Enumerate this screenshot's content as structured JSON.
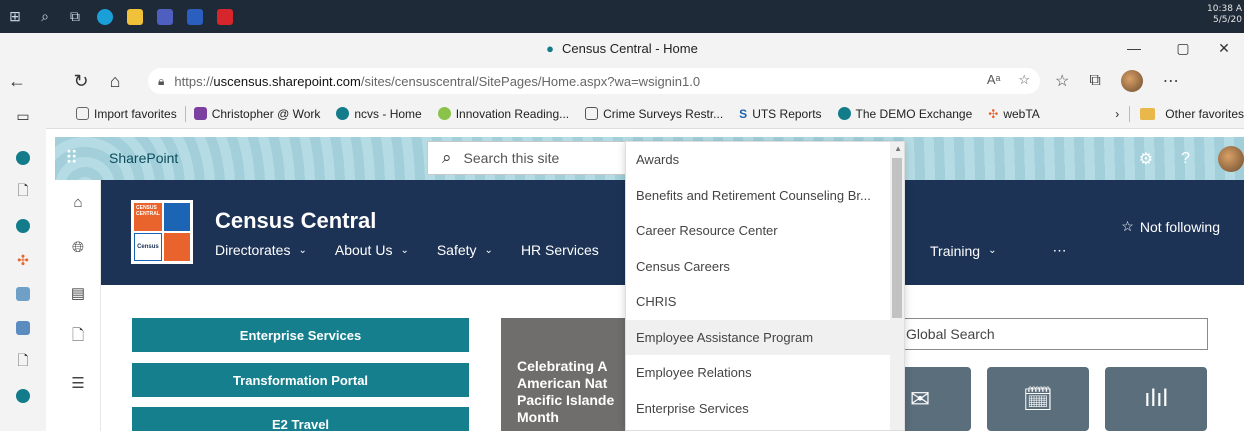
{
  "taskbar": {
    "clock_time": "10:38 A",
    "clock_date": "5/5/20"
  },
  "window": {
    "title": "Census Central - Home",
    "minimize": "—",
    "restore": "▢",
    "close": "✕"
  },
  "address": {
    "url_prefix": "https://",
    "url_host": "uscensus.sharepoint.com",
    "url_path": "/sites/censuscentral/SitePages/Home.aspx?wa=wsignin1.0",
    "read_aloud": "Aᵃ",
    "more": "⋯"
  },
  "favorites": {
    "items": [
      {
        "label": "Import favorites",
        "color": "#666666"
      },
      {
        "label": "Christopher @ Work",
        "color": "#7b3fa0"
      },
      {
        "label": "ncvs - Home",
        "color": "#137c8a"
      },
      {
        "label": "Innovation Reading...",
        "color": "#8bc34a"
      },
      {
        "label": "Crime Surveys Restr...",
        "color": "#555555"
      },
      {
        "label": "UTS Reports",
        "color": "#1c64b4"
      },
      {
        "label": "The DEMO Exchange",
        "color": "#137c8a"
      },
      {
        "label": "webTA",
        "color": "#e8642c"
      }
    ],
    "overflow": "›",
    "other_favorites": "Other favorites"
  },
  "suite": {
    "app_name": "SharePoint",
    "search_placeholder": "Search this site"
  },
  "site": {
    "logo_text_top": "CENSUS CENTRAL",
    "logo_text_bottom": "Census",
    "title": "Census Central",
    "nav": [
      {
        "label": "Directorates",
        "chevron": "⌄"
      },
      {
        "label": "About Us",
        "chevron": "⌄"
      },
      {
        "label": "Safety",
        "chevron": "⌄"
      },
      {
        "label": "HR Services",
        "chevron": ""
      }
    ],
    "nav_right": [
      {
        "label": "Training",
        "chevron": "⌄"
      },
      {
        "label": "⋯",
        "chevron": ""
      }
    ],
    "not_following": "Not following"
  },
  "content": {
    "quick_links": [
      "Enterprise Services",
      "Transformation Portal",
      "E2 Travel"
    ],
    "hero_text": [
      "Celebrating A",
      "American Nat",
      "Pacific Islande",
      "Month"
    ],
    "global_search_placeholder": "Global Search"
  },
  "dropdown": {
    "items": [
      "Awards",
      "Benefits and Retirement Counseling Br...",
      "Career Resource Center",
      "Census Careers",
      "CHRIS",
      "Employee Assistance Program",
      "Employee Relations",
      "Enterprise Services"
    ],
    "hover_index": 5
  },
  "colors": {
    "suite_bar": "#a9d4de",
    "site_header": "#1c3355",
    "quick_link": "#157f8d",
    "tile": "#5b6e7c"
  }
}
